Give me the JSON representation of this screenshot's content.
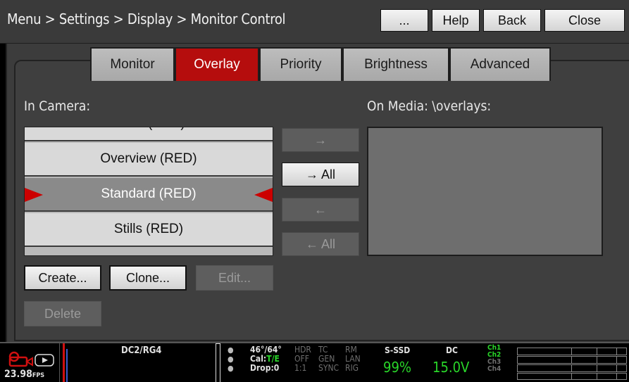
{
  "header": {
    "breadcrumb": "Menu > Settings > Display > Monitor Control",
    "buttons": {
      "more": "...",
      "help": "Help",
      "back": "Back",
      "close": "Close"
    }
  },
  "tabs": [
    {
      "label": "Monitor",
      "active": false
    },
    {
      "label": "Overlay",
      "active": true
    },
    {
      "label": "Priority",
      "active": false
    },
    {
      "label": "Brightness",
      "active": false
    },
    {
      "label": "Advanced",
      "active": false
    }
  ],
  "in_camera": {
    "label": "In Camera:",
    "items": [
      "None (RED)",
      "Overview (RED)",
      "Standard (RED)",
      "Stills (RED)"
    ],
    "selected": "Standard (RED)"
  },
  "on_media": {
    "label": "On Media: \\overlays:"
  },
  "transfer": {
    "right": "→",
    "right_all": "→ All",
    "left": "←",
    "left_all": "← All"
  },
  "actions": {
    "create": "Create...",
    "clone": "Clone...",
    "edit": "Edit...",
    "delete": "Delete"
  },
  "status": {
    "fps": "23.98",
    "fps_unit": "FPS",
    "format": "DC2/RG4",
    "temp": "46°/64°",
    "cal_label": "Cal:",
    "cal_value": "T/E",
    "drop": "Drop:0",
    "flags_row1": [
      "HDR",
      "TC",
      "RM"
    ],
    "flags_row2": [
      "OFF",
      "GEN",
      "LAN"
    ],
    "flags_row3": [
      "1:1",
      "SYNC",
      "RIG"
    ],
    "media_label": "S-SSD",
    "media_value": "99%",
    "power_label": "DC",
    "power_value": "15.0V",
    "channels": [
      "Ch1",
      "Ch2",
      "Ch3",
      "Ch4"
    ],
    "colors": {
      "accent": "#b50d0d",
      "green": "#29d629"
    }
  }
}
